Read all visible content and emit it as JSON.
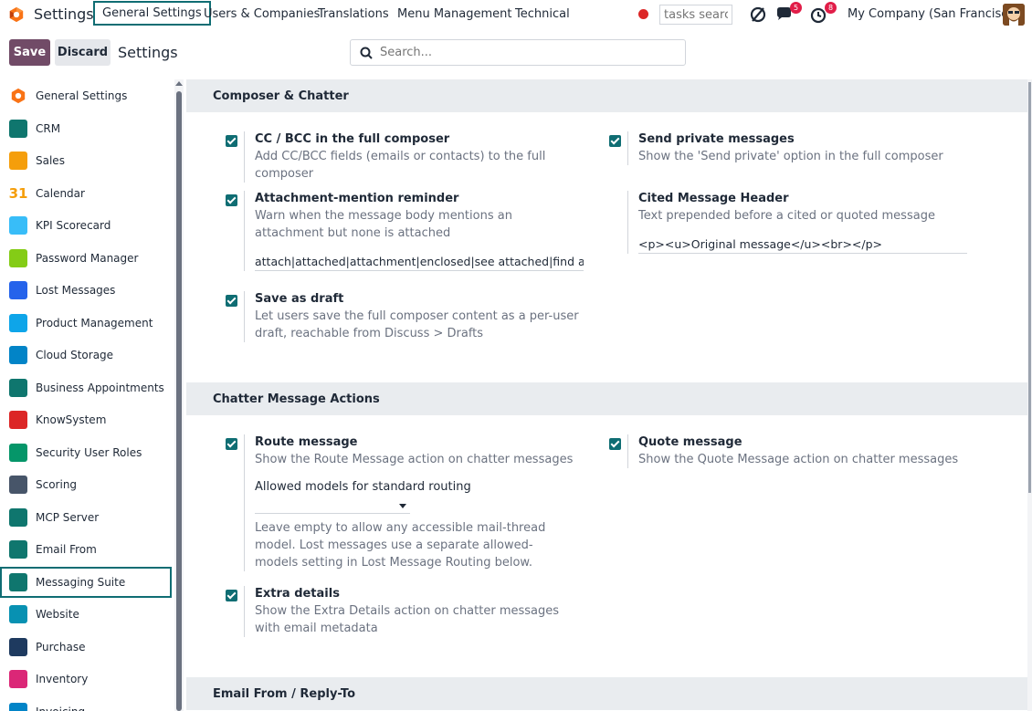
{
  "navbar": {
    "app_name": "Settings",
    "menu": [
      "General Settings",
      "Users & Companies",
      "Translations",
      "Menu Management",
      "Technical"
    ],
    "tasks_search_placeholder": "tasks search",
    "chat_badge": "5",
    "activity_badge": "8",
    "company": "My Company (San Francisco)"
  },
  "control_panel": {
    "save_label": "Save",
    "discard_label": "Discard",
    "title": "Settings",
    "search_placeholder": "Search..."
  },
  "sidebar": {
    "items": [
      {
        "label": "General Settings",
        "icon": "odoo-logo-icon",
        "color": "#f97316"
      },
      {
        "label": "CRM",
        "icon": "crm-icon",
        "color": "#0f766e"
      },
      {
        "label": "Sales",
        "icon": "sales-chart-icon",
        "color": "#f59e0b"
      },
      {
        "label": "Calendar",
        "icon": "calendar-31-icon",
        "color": "#f59e0b"
      },
      {
        "label": "KPI Scorecard",
        "icon": "kpi-scorecard-icon",
        "color": "#38bdf8"
      },
      {
        "label": "Password Manager",
        "icon": "password-manager-icon",
        "color": "#84cc16"
      },
      {
        "label": "Lost Messages",
        "icon": "lost-messages-icon",
        "color": "#2563eb"
      },
      {
        "label": "Product Management",
        "icon": "product-management-icon",
        "color": "#0ea5e9"
      },
      {
        "label": "Cloud Storage",
        "icon": "cloud-storage-icon",
        "color": "#0284c7"
      },
      {
        "label": "Business Appointments",
        "icon": "appointments-icon",
        "color": "#0f766e"
      },
      {
        "label": "KnowSystem",
        "icon": "knowsystem-books-icon",
        "color": "#dc2626"
      },
      {
        "label": "Security User Roles",
        "icon": "security-roles-icon",
        "color": "#059669"
      },
      {
        "label": "Scoring",
        "icon": "scoring-icon",
        "color": "#475569"
      },
      {
        "label": "MCP Server",
        "icon": "mcp-server-icon",
        "color": "#0f766e"
      },
      {
        "label": "Email From",
        "icon": "email-from-icon",
        "color": "#0f766e"
      },
      {
        "label": "Messaging Suite",
        "icon": "messaging-suite-icon",
        "color": "#0f766e"
      },
      {
        "label": "Website",
        "icon": "website-icon",
        "color": "#0891b2"
      },
      {
        "label": "Purchase",
        "icon": "purchase-icon",
        "color": "#1e3a5f"
      },
      {
        "label": "Inventory",
        "icon": "inventory-icon",
        "color": "#db2777"
      },
      {
        "label": "Invoicing",
        "icon": "invoicing-icon",
        "color": "#0284c7"
      }
    ],
    "active_index": 15
  },
  "sections": {
    "composer": {
      "title": "Composer & Chatter",
      "cc_bcc_title": "CC / BCC in the full composer",
      "cc_bcc_desc": "Add CC/BCC fields (emails or contacts) to the full composer",
      "private_title": "Send private messages",
      "private_desc": "Show the 'Send private' option in the full composer",
      "attachment_title": "Attachment-mention reminder",
      "attachment_desc": "Warn when the message body mentions an attachment but none is attached",
      "attachment_value": "attach|attached|attachment|enclosed|see attached|find attached",
      "cited_title": "Cited Message Header",
      "cited_desc": "Text prepended before a cited or quoted message",
      "cited_value": "<p><u>Original message</u><br></p>",
      "draft_title": "Save as draft",
      "draft_desc": "Let users save the full composer content as a per-user draft, reachable from Discuss > Drafts"
    },
    "actions": {
      "title": "Chatter Message Actions",
      "route_title": "Route message",
      "route_desc": "Show the Route Message action on chatter messages",
      "route_models_label": "Allowed models for standard routing",
      "route_models_help": "Leave empty to allow any accessible mail-thread model. Lost messages use a separate allowed-models setting in Lost Message Routing below.",
      "quote_title": "Quote message",
      "quote_desc": "Show the Quote Message action on chatter messages",
      "extra_title": "Extra details",
      "extra_desc": "Show the Extra Details action on chatter messages with email metadata"
    },
    "email_from": {
      "title": "Email From / Reply-To"
    }
  }
}
